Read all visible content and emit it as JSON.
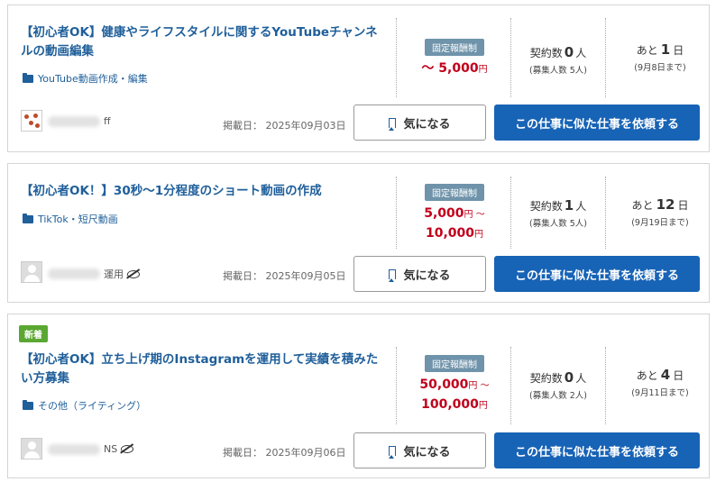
{
  "jobs": [
    {
      "title": "【初心者OK】健康やライフスタイルに関するYouTubeチャンネルの動画編集",
      "category": "YouTube動画作成・編集",
      "price_type": "固定報酬制",
      "price_line1": "～ 5,000",
      "price_line1_unit": "円",
      "price_line2": "",
      "price_line2_unit": "",
      "contract_label": "契約数",
      "contract_count": "0",
      "contract_unit": "人",
      "recruit": "(募集人数 5人)",
      "deadline_prefix": "あと",
      "deadline_days": "1",
      "deadline_unit": "日",
      "deadline_date": "(9月8日まで)",
      "user_suffix": "ff",
      "posted": "掲載日： 2025年09月03日",
      "fav_label": "気になる",
      "similar_label": "この仕事に似た仕事を依頼する"
    },
    {
      "title": "【初心者OK！】30秒〜1分程度のショート動画の作成",
      "category": "TikTok・短尺動画",
      "price_type": "固定報酬制",
      "price_line1": "5,000",
      "price_line1_unit": "円 ～",
      "price_line2": "10,000",
      "price_line2_unit": "円",
      "contract_label": "契約数",
      "contract_count": "1",
      "contract_unit": "人",
      "recruit": "(募集人数 5人)",
      "deadline_prefix": "あと",
      "deadline_days": "12",
      "deadline_unit": "日",
      "deadline_date": "(9月19日まで)",
      "user_suffix": "運用",
      "posted": "掲載日： 2025年09月05日",
      "fav_label": "気になる",
      "similar_label": "この仕事に似た仕事を依頼する"
    },
    {
      "badge": "新着",
      "title": "【初心者OK】立ち上げ期のInstagramを運用して実績を積みたい方募集",
      "category": "その他（ライティング）",
      "price_type": "固定報酬制",
      "price_line1": "50,000",
      "price_line1_unit": "円 ～",
      "price_line2": "100,000",
      "price_line2_unit": "円",
      "contract_label": "契約数",
      "contract_count": "0",
      "contract_unit": "人",
      "recruit": "(募集人数 2人)",
      "deadline_prefix": "あと",
      "deadline_days": "4",
      "deadline_unit": "日",
      "deadline_date": "(9月11日まで)",
      "user_suffix": "NS",
      "posted": "掲載日： 2025年09月06日",
      "fav_label": "気になる",
      "similar_label": "この仕事に似た仕事を依頼する"
    }
  ],
  "colors": {
    "title": "#1f5f9a",
    "price": "#c0001b",
    "primary_button": "#1763b6",
    "new_badge": "#5aa832",
    "price_badge": "#6f93aa"
  }
}
